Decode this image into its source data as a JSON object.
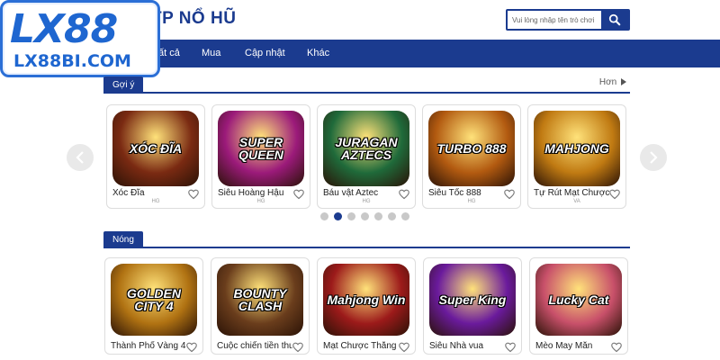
{
  "header": {
    "title": "TP NỔ HŨ",
    "search_placeholder": "Vui lòng nhập tên trò chơi"
  },
  "logo": {
    "main": "LX88",
    "sub": "LX88BI.COM"
  },
  "nav": {
    "items": [
      {
        "label": "ất cả"
      },
      {
        "label": "Mua"
      },
      {
        "label": "Cập nhật"
      },
      {
        "label": "Khác"
      }
    ]
  },
  "section_suggest": {
    "tab": "Gợi ý",
    "more": "Hơn"
  },
  "section_hot": {
    "tab": "Nóng"
  },
  "suggest_games": [
    {
      "name": "Xóc Đĩa",
      "provider": "HG",
      "art": "XÓC ĐĨA",
      "color": "#7a2a12"
    },
    {
      "name": "Siêu Hoàng Hậu",
      "provider": "HG",
      "art": "SUPER QUEEN",
      "color": "#9b1a7a"
    },
    {
      "name": "Báu vật Aztec",
      "provider": "HG",
      "art": "JURAGAN AZTECS",
      "color": "#1f6a3a"
    },
    {
      "name": "Siêu Tốc 888",
      "provider": "HG",
      "art": "TURBO 888",
      "color": "#b25a10"
    },
    {
      "name": "Tự Rút Mạt Chược",
      "provider": "VA",
      "art": "MAHJONG",
      "color": "#c07a12"
    }
  ],
  "hot_games": [
    {
      "name": "Thành Phố Vàng 4",
      "provider": "",
      "art": "GOLDEN CITY 4",
      "color": "#b07212"
    },
    {
      "name": "Cuộc chiến tiền thưởng",
      "provider": "",
      "art": "BOUNTY CLASH",
      "color": "#6a3d1c"
    },
    {
      "name": "Mạt Chược Thắng",
      "provider": "",
      "art": "Mahjong Win",
      "color": "#9c1a1a"
    },
    {
      "name": "Siêu Nhà vua",
      "provider": "",
      "art": "Super King",
      "color": "#6a1a9c"
    },
    {
      "name": "Mèo May Mắn",
      "provider": "",
      "art": "Lucky Cat",
      "color": "#c8506a"
    }
  ],
  "carousel": {
    "dot_count": 7,
    "active_index": 1
  },
  "colors": {
    "brand": "#1b3b8f",
    "logo": "#1e66d0"
  },
  "icons": [
    "search-icon",
    "heart-icon",
    "chevron-left-icon",
    "chevron-right-icon",
    "caret-right-icon"
  ]
}
